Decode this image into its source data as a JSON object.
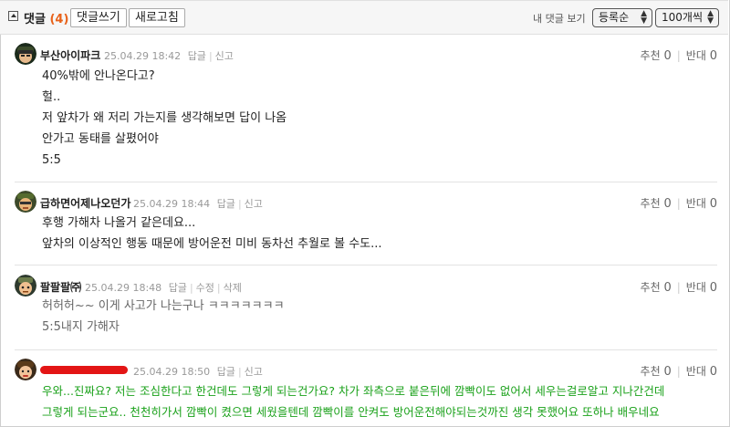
{
  "header": {
    "title": "댓글",
    "count": "(4)",
    "write_button": "댓글쓰기",
    "refresh_button": "새로고침",
    "my_comments": "내 댓글 보기",
    "sort_select": "등록순",
    "per_page_select": "100개씩"
  },
  "comments": [
    {
      "nickname": "부산아이파크",
      "date": "25.04.29 18:42",
      "actions": [
        "답글",
        "신고"
      ],
      "recommend_label": "추천",
      "recommend": "0",
      "oppose_label": "반대",
      "oppose": "0",
      "lines": [
        "40%밖에 안나온다고?",
        "헐..",
        "저 앞차가 왜 저리 가는지를 생각해보면 답이 나옴",
        "안가고 동태를 살폈어야",
        "5:5"
      ]
    },
    {
      "nickname": "급하면어제나오던가",
      "date": "25.04.29 18:44",
      "actions": [
        "답글",
        "신고"
      ],
      "recommend_label": "추천",
      "recommend": "0",
      "oppose_label": "반대",
      "oppose": "0",
      "lines": [
        "후행 가해차 나올거 같은데요...",
        "앞차의 이상적인 행동 때문에 방어운전 미비 동차선 추월로 볼 수도..."
      ]
    },
    {
      "nickname": "팔팔팔㈜",
      "date": "25.04.29 18:48",
      "actions": [
        "답글",
        "수정",
        "삭제"
      ],
      "recommend_label": "추천",
      "recommend": "0",
      "oppose_label": "반대",
      "oppose": "0",
      "lines": [
        "허허허~~ 이게 사고가 나는구나 ㅋㅋㅋㅋㅋㅋㅋ",
        "5:5내지 가해자"
      ]
    },
    {
      "nickname": "",
      "date": "25.04.29 18:50",
      "actions": [
        "답글",
        "신고"
      ],
      "recommend_label": "추천",
      "recommend": "0",
      "oppose_label": "반대",
      "oppose": "0",
      "lines": [
        "우와...진짜요? 저는 조심한다고 한건데도 그렇게 되는건가요? 차가 좌측으로 붙은뒤에 깜빡이도 없어서 세우는걸로알고 지나간건데",
        "그렇게 되는군요.. 천천히가서 깜빡이 켰으면 세웠을텐데 깜빡이를 안켜도 방어운전해야되는것까진 생각 못했어요 또하나 배우네요"
      ]
    }
  ],
  "colors": {
    "count": "#e8621a",
    "author_text": "#1aa11a",
    "redaction": "#e31515"
  },
  "icons": {
    "toggle": "collapse-toggle-icon",
    "sort_arrows": "updown-arrow-icon"
  }
}
